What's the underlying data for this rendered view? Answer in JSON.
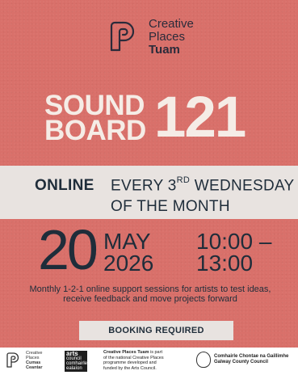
{
  "logo": {
    "icon": "creative-places-logo-icon",
    "line1": "Creative",
    "line2": "Places",
    "line3": "Tuam"
  },
  "title": {
    "line1": "SOUND",
    "line2": "BOARD",
    "number": "121"
  },
  "schedule": {
    "mode": "ONLINE",
    "every_prefix": "EVERY 3",
    "every_sup": "RD",
    "every_suffix": " WEDNESDAY",
    "line2": "OF THE MONTH"
  },
  "date": {
    "day": "20",
    "month": "MAY",
    "year": "2026",
    "time_start": "10:00 –",
    "time_end": "13:00"
  },
  "description": "Monthly 1-2-1 online support sessions for artists to test ideas, receive feedback and move projects forward",
  "booking": "BOOKING REQUIRED",
  "footer": {
    "cp_logo": {
      "icon": "creative-places-logo-icon",
      "line1": "Creative",
      "line2": "Places",
      "line3": "Cumas",
      "line4": "Ceantar"
    },
    "arts_logo": {
      "line1": "arts",
      "line2": "council",
      "line3": "comhairle",
      "line4": "ealaíon"
    },
    "info": {
      "bold": "Creative Places Tuam",
      "rest1": " is part",
      "line2": "of the national Creative Places",
      "line3": "programme developed and",
      "line4": "funded by the Arts Council."
    },
    "gcc": {
      "icon": "county-crest-icon",
      "line1": "Comhairle Chontae na Gaillimhe",
      "line2": "Galway County Council"
    }
  },
  "colors": {
    "background": "#d9706a",
    "band": "#e8e3e0",
    "text_dark": "#1f2d3a",
    "title_light": "#f5ece6"
  }
}
